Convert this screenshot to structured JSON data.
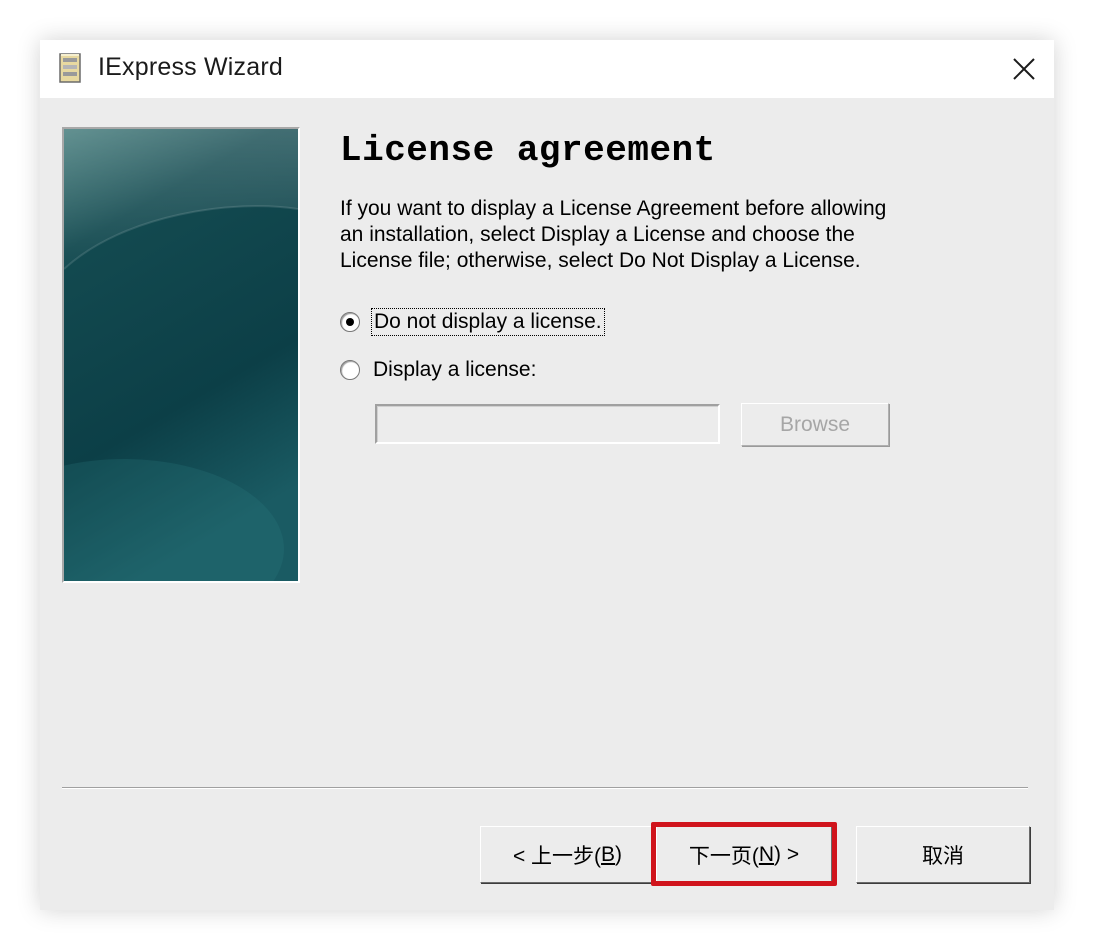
{
  "window": {
    "title": "IExpress Wizard",
    "close_glyph": "✕"
  },
  "page": {
    "heading": "License agreement",
    "description": "If you want to display a License Agreement before allowing\nan installation, select Display a License and choose the\nLicense file; otherwise, select Do Not Display a License."
  },
  "options": {
    "no_license": {
      "label": "Do not display a license.",
      "checked": true
    },
    "display_license": {
      "label": "Display a license:",
      "checked": false
    }
  },
  "license_file": {
    "value": "",
    "enabled": false
  },
  "browse": {
    "label": "Browse",
    "enabled": false
  },
  "footer": {
    "back": {
      "prefix": "< 上一步(",
      "mnemonic": "B",
      "suffix": ")"
    },
    "next": {
      "prefix": "下一页(",
      "mnemonic": "N",
      "suffix": ") >"
    },
    "cancel": {
      "label": "取消"
    }
  },
  "annotation": {
    "highlight_color": "#d0141c",
    "highlights": "next-button"
  },
  "colors": {
    "side_panel_dark": "#0d3a40",
    "side_panel_light": "#2f6e72"
  }
}
